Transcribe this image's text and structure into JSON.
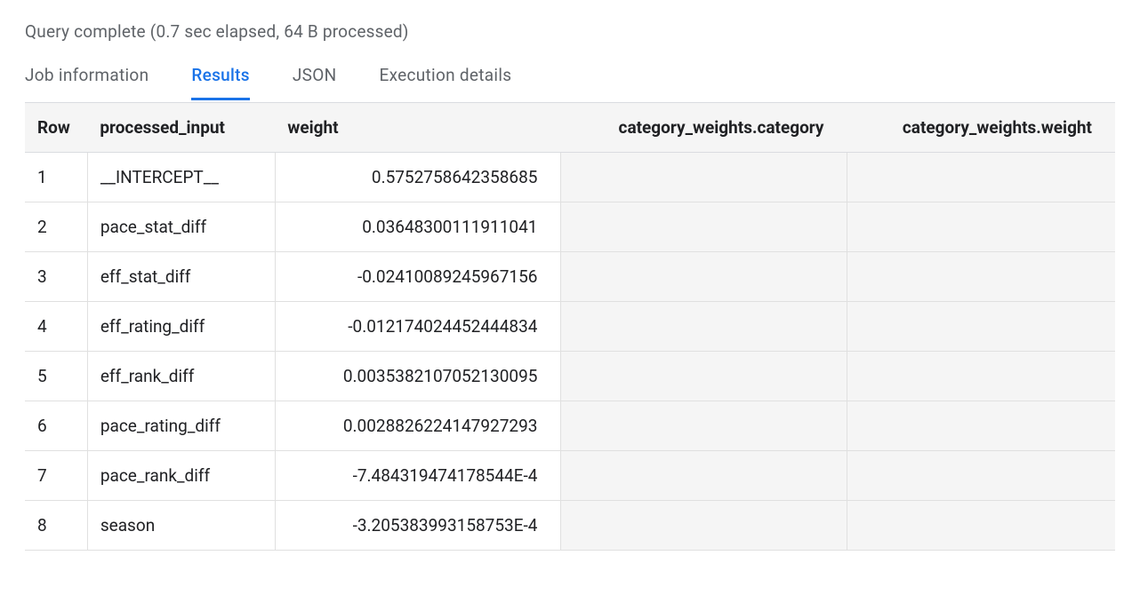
{
  "status": "Query complete (0.7 sec elapsed, 64 B processed)",
  "tabs": {
    "job_information": "Job information",
    "results": "Results",
    "json": "JSON",
    "execution_details": "Execution details"
  },
  "table": {
    "headers": {
      "row": "Row",
      "processed_input": "processed_input",
      "weight": "weight",
      "category_weights_category": "category_weights.category",
      "category_weights_weight": "category_weights.weight"
    },
    "rows": [
      {
        "row": "1",
        "processed_input": "__INTERCEPT__",
        "weight": "0.5752758642358685",
        "cat": "",
        "catw": ""
      },
      {
        "row": "2",
        "processed_input": "pace_stat_diff",
        "weight": "0.03648300111911041",
        "cat": "",
        "catw": ""
      },
      {
        "row": "3",
        "processed_input": "eff_stat_diff",
        "weight": "-0.02410089245967156",
        "cat": "",
        "catw": ""
      },
      {
        "row": "4",
        "processed_input": "eff_rating_diff",
        "weight": "-0.012174024452444834",
        "cat": "",
        "catw": ""
      },
      {
        "row": "5",
        "processed_input": "eff_rank_diff",
        "weight": "0.0035382107052130095",
        "cat": "",
        "catw": ""
      },
      {
        "row": "6",
        "processed_input": "pace_rating_diff",
        "weight": "0.0028826224147927293",
        "cat": "",
        "catw": ""
      },
      {
        "row": "7",
        "processed_input": "pace_rank_diff",
        "weight": "-7.484319474178544E-4",
        "cat": "",
        "catw": ""
      },
      {
        "row": "8",
        "processed_input": "season",
        "weight": "-3.205383993158753E-4",
        "cat": "",
        "catw": ""
      }
    ]
  }
}
